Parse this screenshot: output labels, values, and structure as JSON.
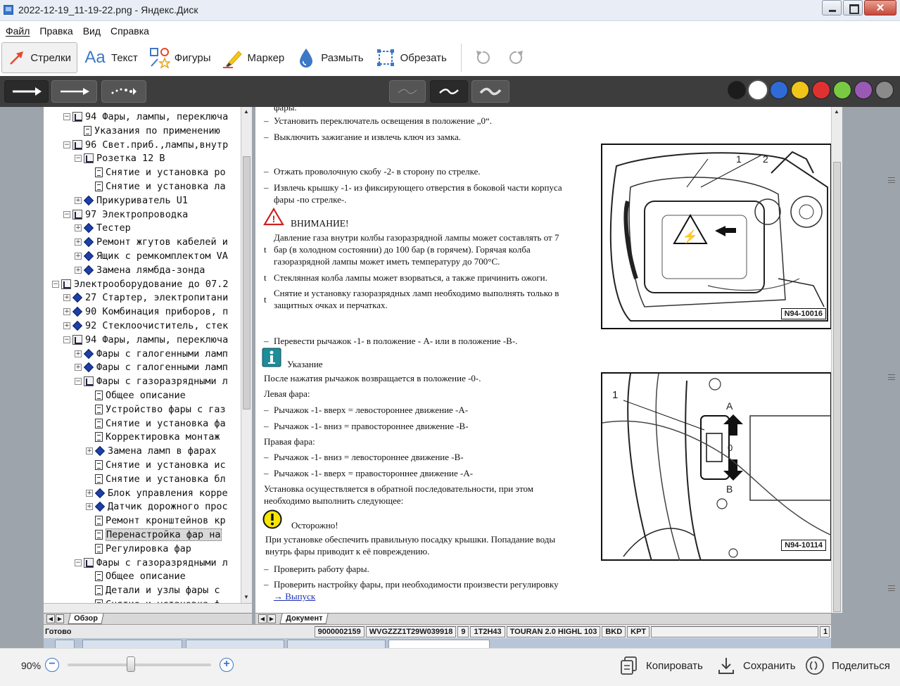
{
  "window": {
    "title": "2022-12-19_11-19-22.png - Яндекс.Диск"
  },
  "menu": [
    "Файл",
    "Правка",
    "Вид",
    "Справка"
  ],
  "toolbar": {
    "tools": [
      {
        "label": "Стрелки",
        "icon": "arrow-tool-icon",
        "active": true
      },
      {
        "label": "Текст",
        "icon": "text-tool-icon",
        "active": false
      },
      {
        "label": "Фигуры",
        "icon": "shapes-tool-icon",
        "active": false
      },
      {
        "label": "Маркер",
        "icon": "marker-tool-icon",
        "active": false
      },
      {
        "label": "Размыть",
        "icon": "blur-tool-icon",
        "active": false
      },
      {
        "label": "Обрезать",
        "icon": "crop-tool-icon",
        "active": false
      }
    ],
    "undo_icon": "undo-icon",
    "redo_icon": "redo-icon"
  },
  "colors": [
    "#1c1c1c",
    "#ffffff",
    "#2f6bd6",
    "#f0c419",
    "#e03131",
    "#7ac943",
    "#9b59b6",
    "#8a8a8a"
  ],
  "tree": {
    "rows": [
      {
        "indent": 1,
        "exp": "−",
        "icon": "book",
        "label": "94 Фары, лампы, переключа"
      },
      {
        "indent": 2,
        "exp": "",
        "icon": "page",
        "label": "Указания по применению"
      },
      {
        "indent": 1,
        "exp": "−",
        "icon": "book",
        "label": "96 Свет.приб.,лампы,внутр"
      },
      {
        "indent": 2,
        "exp": "−",
        "icon": "book",
        "label": "Розетка 12 В"
      },
      {
        "indent": 3,
        "exp": "",
        "icon": "page",
        "label": "Снятие и установка ро"
      },
      {
        "indent": 3,
        "exp": "",
        "icon": "page",
        "label": "Снятие и установка ла"
      },
      {
        "indent": 2,
        "exp": "+",
        "icon": "diamond",
        "label": "Прикуриватель U1"
      },
      {
        "indent": 1,
        "exp": "−",
        "icon": "book",
        "label": "97 Электропроводка"
      },
      {
        "indent": 2,
        "exp": "+",
        "icon": "diamond",
        "label": "Тестер"
      },
      {
        "indent": 2,
        "exp": "+",
        "icon": "diamond",
        "label": "Ремонт жгутов кабелей и"
      },
      {
        "indent": 2,
        "exp": "+",
        "icon": "diamond",
        "label": "Ящик с ремкомплектом VA"
      },
      {
        "indent": 2,
        "exp": "+",
        "icon": "diamond",
        "label": "Замена лямбда-зонда"
      },
      {
        "indent": 0,
        "exp": "−",
        "icon": "book",
        "label": "Электрооборудование до 07.2"
      },
      {
        "indent": 1,
        "exp": "+",
        "icon": "diamond",
        "label": "27 Стартер, электропитани"
      },
      {
        "indent": 1,
        "exp": "+",
        "icon": "diamond",
        "label": "90 Комбинация приборов, п"
      },
      {
        "indent": 1,
        "exp": "+",
        "icon": "diamond",
        "label": "92 Стеклоочиститель, стек"
      },
      {
        "indent": 1,
        "exp": "−",
        "icon": "book",
        "label": "94 Фары, лампы, переключа"
      },
      {
        "indent": 2,
        "exp": "+",
        "icon": "diamond",
        "label": "Фары с галогенными ламп"
      },
      {
        "indent": 2,
        "exp": "+",
        "icon": "diamond",
        "label": "Фары с галогенными ламп"
      },
      {
        "indent": 2,
        "exp": "−",
        "icon": "book",
        "label": "Фары с газоразрядными л"
      },
      {
        "indent": 3,
        "exp": "",
        "icon": "page",
        "label": "Общее описание"
      },
      {
        "indent": 3,
        "exp": "",
        "icon": "page",
        "label": "Устройство фары с газ"
      },
      {
        "indent": 3,
        "exp": "",
        "icon": "page",
        "label": "Снятие и установка фа"
      },
      {
        "indent": 3,
        "exp": "",
        "icon": "page",
        "label": "Корректировка монтаж"
      },
      {
        "indent": 3,
        "exp": "+",
        "icon": "diamond",
        "label": "Замена ламп в фарах"
      },
      {
        "indent": 3,
        "exp": "",
        "icon": "page",
        "label": "Снятие и установка ис"
      },
      {
        "indent": 3,
        "exp": "",
        "icon": "page",
        "label": "Снятие и установка бл"
      },
      {
        "indent": 3,
        "exp": "+",
        "icon": "diamond",
        "label": "Блок управления корре"
      },
      {
        "indent": 3,
        "exp": "+",
        "icon": "diamond",
        "label": "Датчик дорожного прос"
      },
      {
        "indent": 3,
        "exp": "",
        "icon": "page",
        "label": "Ремонт кронштейнов кр"
      },
      {
        "indent": 3,
        "exp": "",
        "icon": "page",
        "label": "Перенастройка фар на",
        "selected": true
      },
      {
        "indent": 3,
        "exp": "",
        "icon": "page",
        "label": "Регулировка фар"
      },
      {
        "indent": 2,
        "exp": "−",
        "icon": "book",
        "label": "Фары с газоразрядными л"
      },
      {
        "indent": 3,
        "exp": "",
        "icon": "page",
        "label": "Общее описание"
      },
      {
        "indent": 3,
        "exp": "",
        "icon": "page",
        "label": "Детали и узлы фары с"
      },
      {
        "indent": 3,
        "exp": "",
        "icon": "page",
        "label": "Снятие и установка ф"
      }
    ],
    "tab_label": "Обзор"
  },
  "document": {
    "tab_label": "Документ",
    "lines": {
      "l0": "фары.",
      "l1": "Установить переключатель освещения в положение „0“.",
      "l2": "Выключить зажигание и извлечь ключ из замка.",
      "l3": "Отжать проволочную скобу -2- в сторону по стрелке.",
      "l4a": "Извлечь крышку -1- из фиксирующего отверстия в боковой части корпуса",
      "l4b": "фары -по стрелке-.",
      "warn_title": "ВНИМАНИЕ!",
      "w1a": "Давление газа внутри колбы газоразрядной лампы может составлять от 7",
      "w1b": "бар (в холодном состоянии) до 100 бар (в горячем). Горячая колба",
      "w1c": "газоразрядной лампы может иметь температуру до 700°С.",
      "w2": "Стеклянная колба лампы может взорваться, а также причинить ожоги.",
      "w3a": "Снятие и установку газоразрядных ламп необходимо выполнять только в",
      "w3b": "защитных очках и перчатках.",
      "bullet": "t",
      "l5": "Перевести рычажок -1- в положение - А- или в положение -В-.",
      "note_title": "Указание",
      "n1": "После нажатия рычажок возвращается в положение -0-.",
      "left_title": "Левая фара:",
      "left1": "Рычажок -1- вверх = левостороннее движение -А-",
      "left2": "Рычажок -1- вниз = правостороннее движение -В-",
      "right_title": "Правая фара:",
      "right1": "Рычажок -1- вниз = левостороннее движение -В-",
      "right2": "Рычажок -1- вверх = правостороннее движение -А-",
      "inst_a": "Установка осуществляется в обратной последовательности, при этом",
      "inst_b": "необходимо выполнить следующее:",
      "caution_title": "Осторожно!",
      "c1a": "При установке обеспечить правильную посадку крышки. Попадание воды",
      "c1b": "внутрь фары приводит к её повреждению.",
      "l6": "Проверить работу фары.",
      "l7": "Проверить настройку фары, при необходимости произвести регулировку",
      "link": "→ Выпуск",
      "dash": "–"
    },
    "figure1": {
      "code": "N94-10016",
      "label1": "1",
      "label2": "2"
    },
    "figure2": {
      "code": "N94-10114",
      "label1": "1",
      "labelA": "A",
      "label0": "0",
      "labelB": "B"
    }
  },
  "status": {
    "ready": "Готово",
    "cells": [
      "9000002159",
      "WVGZZZ1T29W039918",
      "9",
      "1T2H43",
      "TOURAN 2.0 HIGHL 103",
      "BKD",
      "KPT",
      "",
      "1"
    ]
  },
  "bottom": {
    "zoom": "90%",
    "zoom_fraction": 0.44,
    "copy": "Копировать",
    "save": "Сохранить",
    "share": "Поделиться"
  }
}
